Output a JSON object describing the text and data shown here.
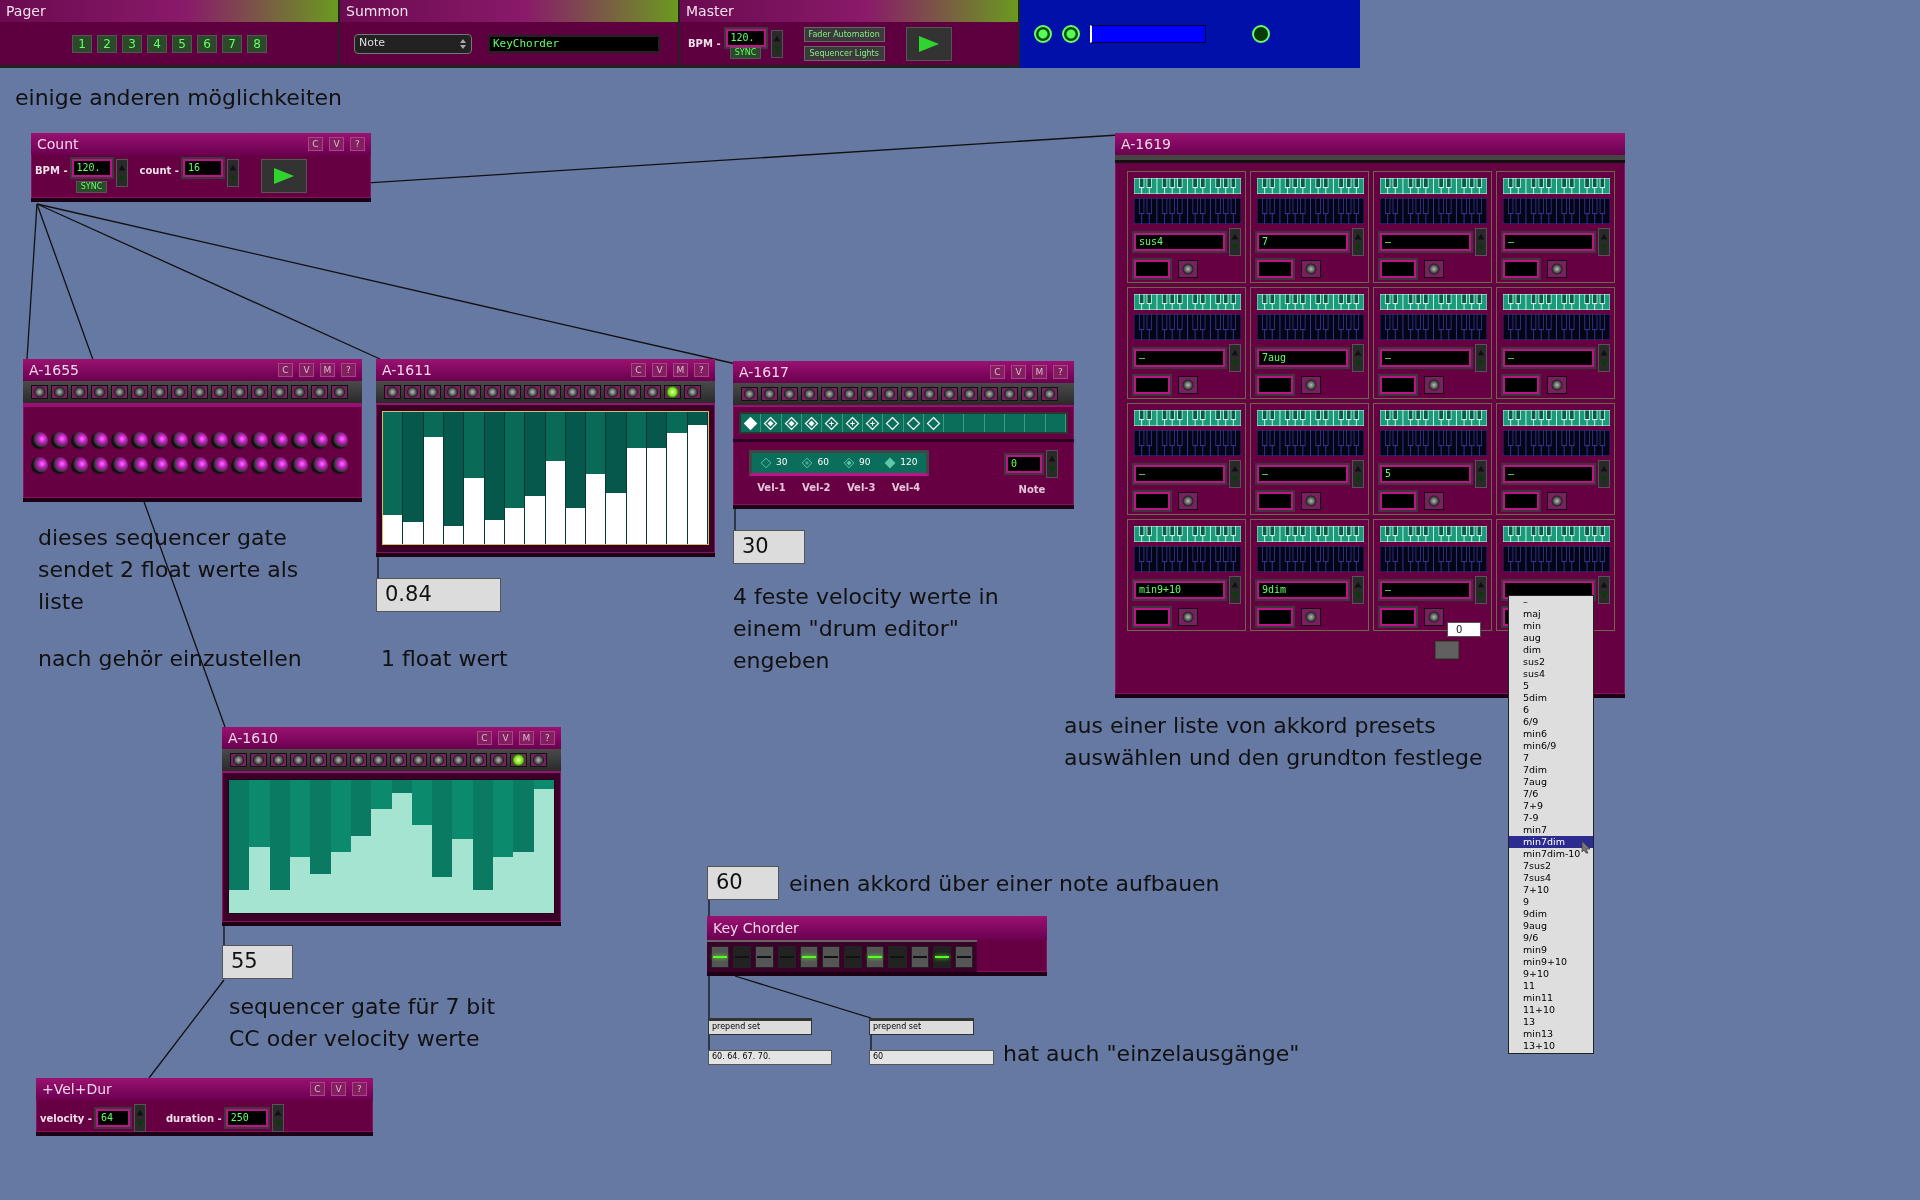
{
  "top_bar": {
    "pager": {
      "title": "Pager",
      "pages": [
        "1",
        "2",
        "3",
        "4",
        "5",
        "6",
        "7",
        "8"
      ]
    },
    "summon": {
      "title": "Summon",
      "menu": "Note",
      "field": "KeyChorder"
    },
    "master": {
      "title": "Master",
      "bpm_label": "BPM -",
      "bpm": "120.",
      "sync": "SYNC",
      "buttons": [
        "Fader Automation",
        "Sequencer Lights"
      ]
    },
    "status_panel": {
      "leds": [
        {
          "on": true
        },
        {
          "on": true
        },
        {
          "on": false
        }
      ]
    }
  },
  "modules": [
    {
      "kind": "count",
      "title": "Count",
      "header_buttons": [
        "C",
        "V",
        "?"
      ],
      "bpm_label": "BPM -",
      "bpm": "120.",
      "sync": "SYNC",
      "count_label": "count -",
      "count": "16"
    },
    {
      "kind": "gate",
      "title": "A-1655",
      "header_buttons": [
        "C",
        "V",
        "M",
        "?"
      ],
      "steps": [
        {
          "on": false
        },
        {
          "on": false
        },
        {
          "on": false
        },
        {
          "on": false
        },
        {
          "on": false
        },
        {
          "on": false
        },
        {
          "on": false
        },
        {
          "on": false
        },
        {
          "on": false
        },
        {
          "on": false
        },
        {
          "on": false
        },
        {
          "on": false
        },
        {
          "on": false
        },
        {
          "on": false
        },
        {
          "on": false
        },
        {
          "on": false
        }
      ]
    },
    {
      "kind": "white_multislider",
      "title": "A-1611",
      "header_buttons": [
        "C",
        "V",
        "M",
        "?"
      ],
      "steps": [
        {
          "on": false
        },
        {
          "on": false
        },
        {
          "on": false
        },
        {
          "on": false
        },
        {
          "on": false
        },
        {
          "on": false
        },
        {
          "on": false
        },
        {
          "on": false
        },
        {
          "on": false
        },
        {
          "on": false
        },
        {
          "on": false
        },
        {
          "on": false
        },
        {
          "on": false
        },
        {
          "on": false
        },
        {
          "on": true
        },
        {
          "on": false
        }
      ],
      "bars": [
        {
          "level": 0.22
        },
        {
          "level": 0.17
        },
        {
          "level": 0.81
        },
        {
          "level": 0.14
        },
        {
          "level": 0.5
        },
        {
          "level": 0.18
        },
        {
          "level": 0.27
        },
        {
          "level": 0.36
        },
        {
          "level": 0.63
        },
        {
          "level": 0.27
        },
        {
          "level": 0.53
        },
        {
          "level": 0.39
        },
        {
          "level": 0.73
        },
        {
          "level": 0.73
        },
        {
          "level": 0.84
        },
        {
          "level": 0.9
        }
      ]
    },
    {
      "kind": "drum",
      "title": "A-1617",
      "header_buttons": [
        "C",
        "V",
        "M",
        "?"
      ],
      "steps": [
        {
          "on": false
        },
        {
          "on": false
        },
        {
          "on": false
        },
        {
          "on": false
        },
        {
          "on": false
        },
        {
          "on": false
        },
        {
          "on": false
        },
        {
          "on": false
        },
        {
          "on": false
        },
        {
          "on": false
        },
        {
          "on": false
        },
        {
          "on": false
        },
        {
          "on": false
        },
        {
          "on": false
        },
        {
          "on": false
        },
        {
          "on": false
        }
      ],
      "cells": [
        {
          "kind": "vel4"
        },
        {
          "kind": "vel3"
        },
        {
          "kind": "vel3"
        },
        {
          "kind": "vel3"
        },
        {
          "kind": "vel2"
        },
        {
          "kind": "vel2"
        },
        {
          "kind": "vel2"
        },
        {
          "kind": "vel1"
        },
        {
          "kind": "vel1"
        },
        {
          "kind": "vel1"
        },
        {
          "kind": "empty"
        },
        {
          "kind": "empty"
        },
        {
          "kind": "empty"
        },
        {
          "kind": "empty"
        },
        {
          "kind": "empty"
        },
        {
          "kind": "empty"
        }
      ],
      "legend": [
        {
          "kind": "vel1",
          "value": "30",
          "label": "Vel-1"
        },
        {
          "kind": "vel2",
          "value": "60",
          "label": "Vel-2"
        },
        {
          "kind": "vel3",
          "value": "90",
          "label": "Vel-3"
        },
        {
          "kind": "vel4",
          "value": "120",
          "label": "Vel-4"
        }
      ],
      "note_label": "Note",
      "note": "0"
    },
    {
      "kind": "chord_grid",
      "title": "A-1619",
      "cells": [
        {
          "chord": "sus4"
        },
        {
          "chord": "7"
        },
        {
          "chord": "–"
        },
        {
          "chord": "–"
        },
        {
          "chord": "–"
        },
        {
          "chord": "7aug"
        },
        {
          "chord": "–"
        },
        {
          "chord": "–"
        },
        {
          "chord": "–"
        },
        {
          "chord": "–"
        },
        {
          "chord": "5"
        },
        {
          "chord": "–"
        },
        {
          "chord": "min9+10"
        },
        {
          "chord": "9dim"
        },
        {
          "chord": "–"
        },
        {}
      ]
    },
    {
      "kind": "mint_multislider",
      "title": "A-1610",
      "header_buttons": [
        "C",
        "V",
        "M",
        "?"
      ],
      "steps": [
        {
          "on": false
        },
        {
          "on": false
        },
        {
          "on": false
        },
        {
          "on": false
        },
        {
          "on": false
        },
        {
          "on": false
        },
        {
          "on": false
        },
        {
          "on": false
        },
        {
          "on": false
        },
        {
          "on": false
        },
        {
          "on": false
        },
        {
          "on": false
        },
        {
          "on": false
        },
        {
          "on": false
        },
        {
          "on": true
        },
        {
          "on": false
        }
      ],
      "bars": [
        {
          "level": 0.17
        },
        {
          "level": 0.5
        },
        {
          "level": 0.17
        },
        {
          "level": 0.42
        },
        {
          "level": 0.29
        },
        {
          "level": 0.46
        },
        {
          "level": 0.58
        },
        {
          "level": 0.78
        },
        {
          "level": 0.9
        },
        {
          "level": 0.66
        },
        {
          "level": 0.27
        },
        {
          "level": 0.56
        },
        {
          "level": 0.17
        },
        {
          "level": 0.42
        },
        {
          "level": 0.46
        },
        {
          "level": 0.93
        }
      ]
    },
    {
      "kind": "vel_dur",
      "title": "+Vel+Dur",
      "header_buttons": [
        "C",
        "V",
        "?"
      ],
      "velocity_label": "velocity -",
      "velocity": "64",
      "duration_label": "duration -",
      "duration": "250"
    },
    {
      "kind": "key_chorder",
      "title": "Key Chorder",
      "keys": [
        {
          "kind": "white",
          "on": true
        },
        {
          "kind": "black",
          "on": false
        },
        {
          "kind": "white",
          "on": false
        },
        {
          "kind": "black",
          "on": false
        },
        {
          "kind": "white",
          "on": true
        },
        {
          "kind": "white",
          "on": false
        },
        {
          "kind": "black",
          "on": false
        },
        {
          "kind": "white",
          "on": true
        },
        {
          "kind": "black",
          "on": false
        },
        {
          "kind": "white",
          "on": false
        },
        {
          "kind": "black",
          "on": true
        },
        {
          "kind": "white",
          "on": false
        }
      ]
    }
  ],
  "number_boxes": [
    {
      "value": "0.84"
    },
    {
      "value": "30"
    },
    {
      "value": "55"
    },
    {
      "value": "60"
    },
    {
      "value": "0"
    }
  ],
  "objects": [
    {
      "text": "prepend set"
    },
    {
      "text": "prepend set"
    }
  ],
  "messages": [
    {
      "text": "60. 64. 67. 70."
    },
    {
      "text": "60"
    }
  ],
  "comments": [
    {
      "lines": [
        "einige anderen möglichkeiten"
      ]
    },
    {
      "lines": [
        "dieses sequencer gate",
        "sendet 2 float werte als",
        "liste"
      ]
    },
    {
      "lines": [
        "nach gehör einzustellen"
      ]
    },
    {
      "lines": [
        "1 float wert"
      ]
    },
    {
      "lines": [
        "4 feste velocity werte in",
        "einem \"drum editor\"",
        "engeben"
      ]
    },
    {
      "lines": [
        "aus einer liste von akkord presets",
        "auswählen und den grundton festlege"
      ]
    },
    {
      "lines": [
        "sequencer gate für 7 bit",
        "CC oder velocity werte"
      ]
    },
    {
      "lines": [
        "einen akkord über einer note aufbauen"
      ]
    },
    {
      "lines": [
        "hat auch \"einzelausgänge\""
      ]
    }
  ],
  "chord_menu": {
    "items": [
      {
        "label": "–",
        "selected": false
      },
      {
        "label": "maj",
        "selected": false
      },
      {
        "label": "min",
        "selected": false
      },
      {
        "label": "aug",
        "selected": false
      },
      {
        "label": "dim",
        "selected": false
      },
      {
        "label": "sus2",
        "selected": false
      },
      {
        "label": "sus4",
        "selected": false
      },
      {
        "label": "5",
        "selected": false
      },
      {
        "label": "5dim",
        "selected": false
      },
      {
        "label": "6",
        "selected": false
      },
      {
        "label": "6/9",
        "selected": false
      },
      {
        "label": "min6",
        "selected": false
      },
      {
        "label": "min6/9",
        "selected": false
      },
      {
        "label": "7",
        "selected": false
      },
      {
        "label": "7dim",
        "selected": false
      },
      {
        "label": "7aug",
        "selected": false
      },
      {
        "label": "7/6",
        "selected": false
      },
      {
        "label": "7+9",
        "selected": false
      },
      {
        "label": "7-9",
        "selected": false
      },
      {
        "label": "min7",
        "selected": false
      },
      {
        "label": "min7dim",
        "selected": true
      },
      {
        "label": "min7dim-10",
        "selected": false
      },
      {
        "label": "7sus2",
        "selected": false
      },
      {
        "label": "7sus4",
        "selected": false
      },
      {
        "label": "7+10",
        "selected": false
      },
      {
        "label": "9",
        "selected": false
      },
      {
        "label": "9dim",
        "selected": false
      },
      {
        "label": "9aug",
        "selected": false
      },
      {
        "label": "9/6",
        "selected": false
      },
      {
        "label": "min9",
        "selected": false
      },
      {
        "label": "min9+10",
        "selected": false
      },
      {
        "label": "9+10",
        "selected": false
      },
      {
        "label": "11",
        "selected": false
      },
      {
        "label": "min11",
        "selected": false
      },
      {
        "label": "11+10",
        "selected": false
      },
      {
        "label": "13",
        "selected": false
      },
      {
        "label": "min13",
        "selected": false
      },
      {
        "label": "13+10",
        "selected": false
      }
    ]
  }
}
